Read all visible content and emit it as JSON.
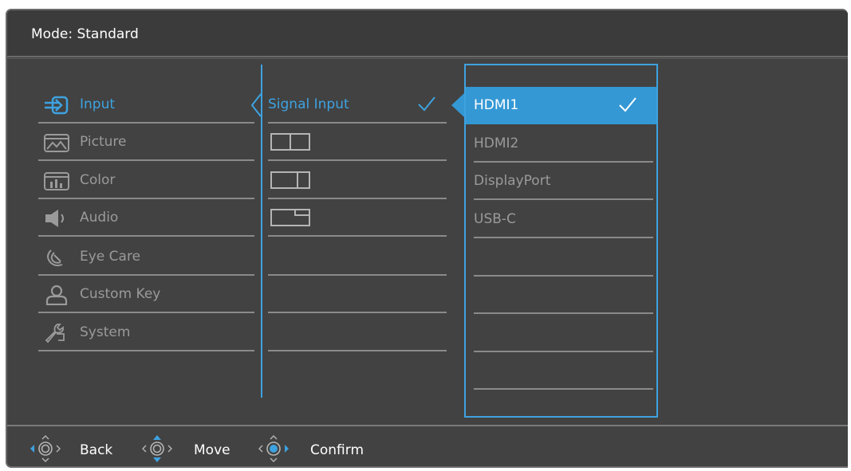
{
  "header": {
    "mode_label": "Mode: Standard"
  },
  "menu": {
    "items": [
      {
        "label": "Input",
        "icon": "input-icon",
        "active": true
      },
      {
        "label": "Picture",
        "icon": "picture-icon",
        "active": false
      },
      {
        "label": "Color",
        "icon": "color-icon",
        "active": false
      },
      {
        "label": "Audio",
        "icon": "speaker-icon",
        "active": false
      },
      {
        "label": "Eye Care",
        "icon": "eye-care-icon",
        "active": false
      },
      {
        "label": "Custom Key",
        "icon": "person-icon",
        "active": false
      },
      {
        "label": "System",
        "icon": "wrench-icon",
        "active": false
      }
    ]
  },
  "submenu": {
    "items": [
      {
        "label": "Signal Input",
        "checked": true
      },
      {
        "label": "",
        "icon": "pbp-layout-icon"
      },
      {
        "label": "",
        "icon": "pbp-layout-alt-icon"
      },
      {
        "label": "",
        "icon": "pip-layout-icon"
      }
    ]
  },
  "sources": {
    "items": [
      {
        "label": "HDMI1",
        "selected": true
      },
      {
        "label": "HDMI2",
        "selected": false
      },
      {
        "label": "DisplayPort",
        "selected": false
      },
      {
        "label": "USB-C",
        "selected": false
      }
    ]
  },
  "footer": {
    "hints": [
      {
        "label": "Back",
        "icon": "joystick-left-icon"
      },
      {
        "label": "Move",
        "icon": "joystick-down-icon"
      },
      {
        "label": "Confirm",
        "icon": "joystick-press-icon"
      }
    ]
  },
  "colors": {
    "accent": "#3ea2e0",
    "selected_bg": "#3498d4",
    "panel_bg": "#424242",
    "inactive_text": "#9a9a9a"
  }
}
